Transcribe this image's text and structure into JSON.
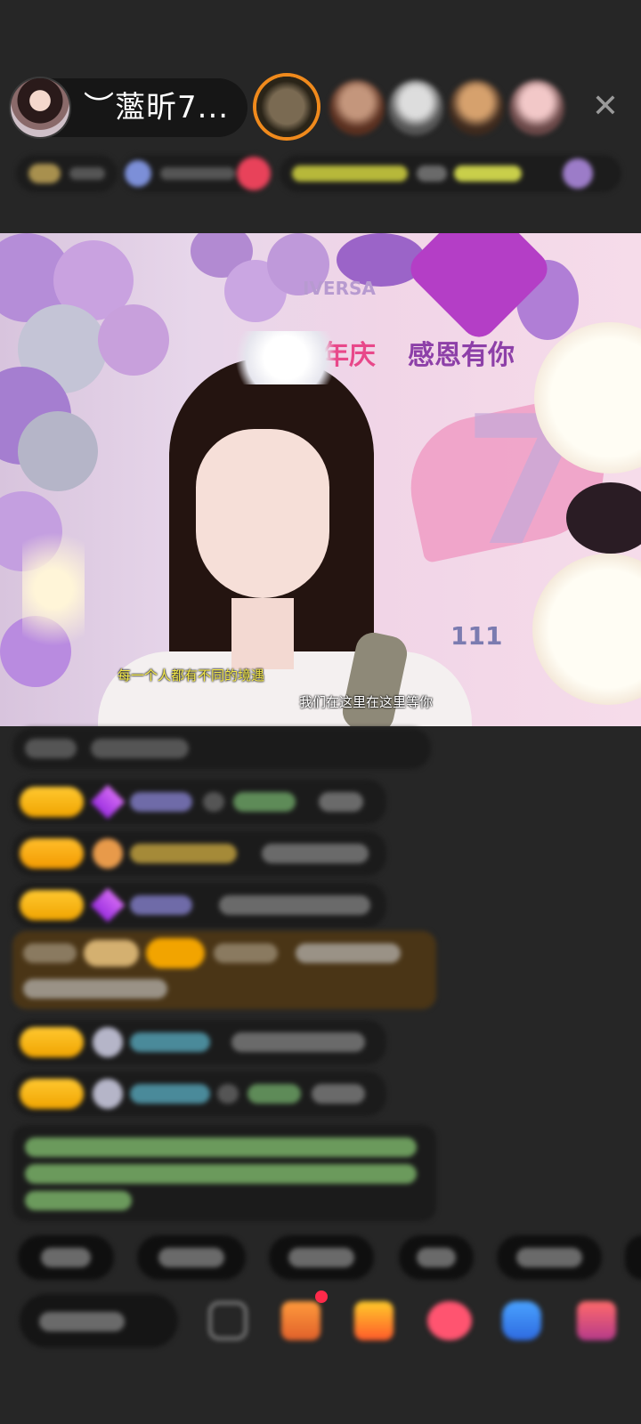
{
  "header": {
    "host_name": "︶蘫昕7...",
    "colors": {
      "pill_bg": "#161616",
      "accent_gift": "#f08a1c"
    }
  },
  "video": {
    "banner_left": "年庆",
    "banner_right": "感恩有你",
    "banner_top": "IVERSA",
    "big_number": "7",
    "number_small": "111",
    "subtitle_left": "每一个人都有不同的境遇",
    "subtitle_right": "我们在这里在这里等你"
  },
  "chat": {
    "message_count": 9,
    "level_badge_color": "#f4b21a",
    "highlight_bg": "#4a3516",
    "system_text_color": "#7fb36a"
  },
  "quick_replies_count": 5,
  "input": {
    "placeholder_blurred": true
  },
  "icons": [
    "close-icon",
    "gift-icon",
    "treasure-icon",
    "heart-icon",
    "game-icon",
    "more-gifts-icon",
    "emoji-icon"
  ]
}
